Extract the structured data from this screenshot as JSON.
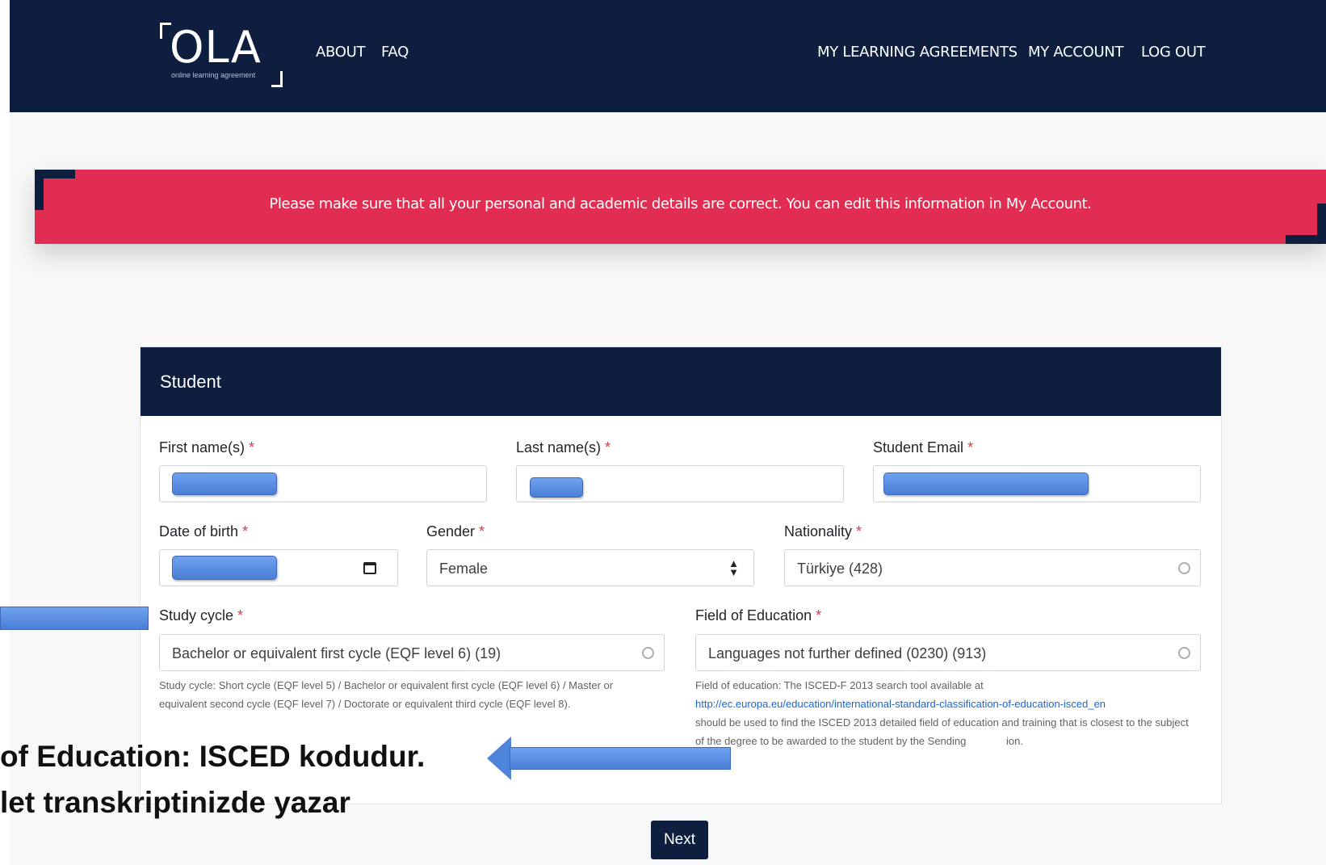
{
  "header": {
    "logo_text": "OLA",
    "logo_subtitle": "online learning agreement",
    "nav_left": [
      "ABOUT",
      "FAQ"
    ],
    "nav_right": [
      "MY LEARNING AGREEMENTS",
      "MY ACCOUNT",
      "LOG OUT"
    ]
  },
  "alert": {
    "message": "Please make sure that all your personal and academic details are correct. You can edit this information in My Account."
  },
  "form": {
    "title": "Student",
    "required_marker": "*",
    "first_name": {
      "label": "First name(s)"
    },
    "last_name": {
      "label": "Last name(s)"
    },
    "email": {
      "label": "Student Email"
    },
    "dob": {
      "label": "Date of birth"
    },
    "gender": {
      "label": "Gender",
      "value": "Female"
    },
    "nationality": {
      "label": "Nationality",
      "value": "Türkiye (428)"
    },
    "study_cycle": {
      "label": "Study cycle",
      "value": "Bachelor or equivalent first cycle (EQF level 6) (19)",
      "help": "Study cycle: Short cycle (EQF level 5) / Bachelor or equivalent first cycle (EQF level 6) / Master or equivalent second cycle (EQF level 7) / Doctorate or equivalent third cycle (EQF level 8)."
    },
    "field_of_education": {
      "label": "Field of Education",
      "value": "Languages not further defined (0230) (913)",
      "help_before": "Field of education: The ISCED-F 2013 search tool available at",
      "help_link": "http://ec.europa.eu/education/international-standard-classification-of-education-isced_en",
      "help_after": "should be used to find the ISCED 2013 detailed field of education and training that is closest to the subject of the degree to be awarded to the student by the Sending ",
      "help_tail": "ion."
    },
    "next_button": "Next"
  },
  "annotations": {
    "line1": "of Education: ISCED kodudur.",
    "line2": "let transkriptinizde yazar"
  },
  "colors": {
    "navy": "#0e1e3f",
    "alert_red": "#e22d52",
    "required_red": "#dc3545",
    "link_blue": "#1a66d8",
    "redaction_blue": "#4a7fd8"
  }
}
